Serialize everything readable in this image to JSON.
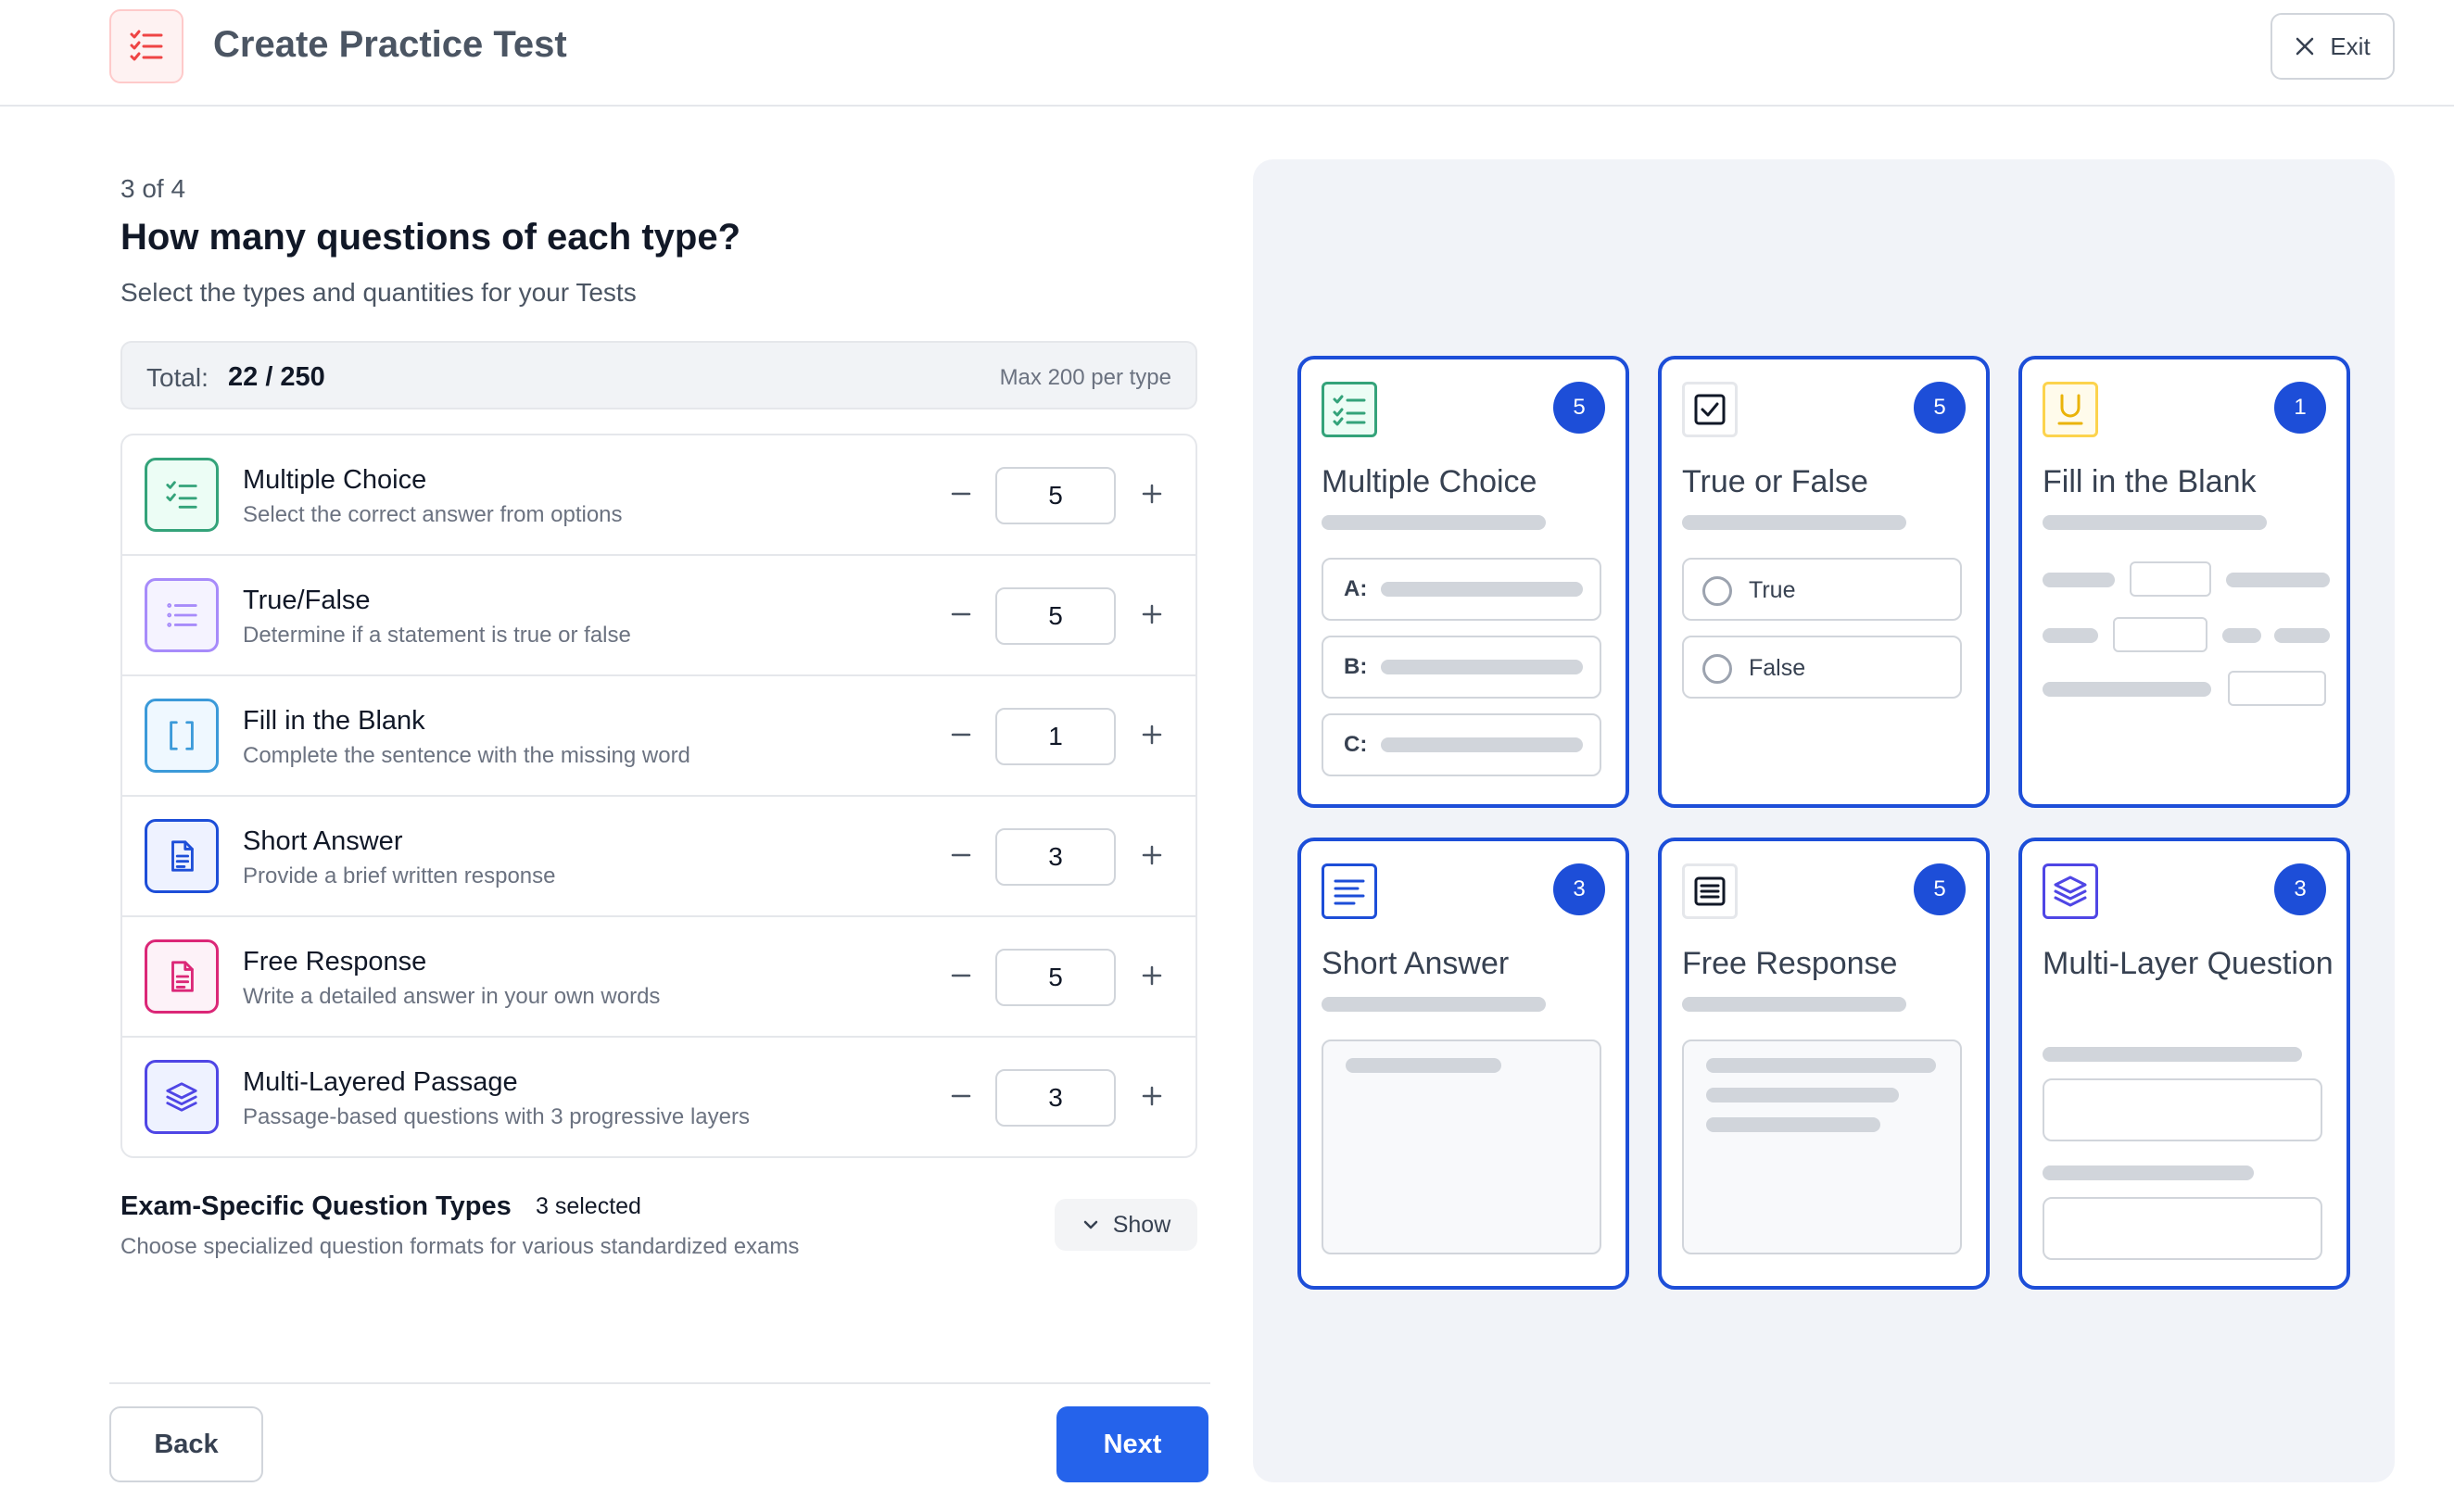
{
  "header": {
    "title": "Create Practice Test",
    "exit_label": "Exit"
  },
  "step": {
    "indicator": "3 of 4",
    "title": "How many questions of each type?",
    "subtitle": "Select the types and quantities for your Tests"
  },
  "total": {
    "label": "Total:",
    "value": "22 / 250",
    "max_note": "Max 200 per type"
  },
  "types": [
    {
      "name": "Multiple Choice",
      "desc": "Select the correct answer from options",
      "value": "5",
      "color": "#34a37a",
      "bg": "#ecfdf5",
      "icon": "checklist-icon"
    },
    {
      "name": "True/False",
      "desc": "Determine if a statement is true or false",
      "value": "5",
      "color": "#a78bfa",
      "bg": "#f5f3ff",
      "icon": "list-icon"
    },
    {
      "name": "Fill in the Blank",
      "desc": "Complete the sentence with the missing word",
      "value": "1",
      "color": "#3b9ad9",
      "bg": "#eff8ff",
      "icon": "brackets-icon"
    },
    {
      "name": "Short Answer",
      "desc": "Provide a brief written response",
      "value": "3",
      "color": "#1d4ed8",
      "bg": "#eef2ff",
      "icon": "document-icon"
    },
    {
      "name": "Free Response",
      "desc": "Write a detailed answer in your own words",
      "value": "5",
      "color": "#db2777",
      "bg": "#fdf2f8",
      "icon": "document-icon"
    },
    {
      "name": "Multi-Layered Passage",
      "desc": "Passage-based questions with 3 progressive layers",
      "value": "3",
      "color": "#4f46e5",
      "bg": "#eef2ff",
      "icon": "layers-icon"
    }
  ],
  "exam": {
    "title": "Exam-Specific Question Types",
    "count": "3 selected",
    "desc": "Choose specialized question formats for various standardized exams",
    "show_label": "Show"
  },
  "footer": {
    "back_label": "Back",
    "next_label": "Next"
  },
  "preview": {
    "accent": "#1d4ed8",
    "cards": [
      {
        "title": "Multiple Choice",
        "badge": "5",
        "options": [
          "A:",
          "B:",
          "C:"
        ]
      },
      {
        "title": "True or False",
        "badge": "5",
        "options": [
          "True",
          "False"
        ]
      },
      {
        "title": "Fill in the Blank",
        "badge": "1"
      },
      {
        "title": "Short Answer",
        "badge": "3"
      },
      {
        "title": "Free Response",
        "badge": "5"
      },
      {
        "title": "Multi-Layer Question",
        "badge": "3"
      }
    ]
  }
}
